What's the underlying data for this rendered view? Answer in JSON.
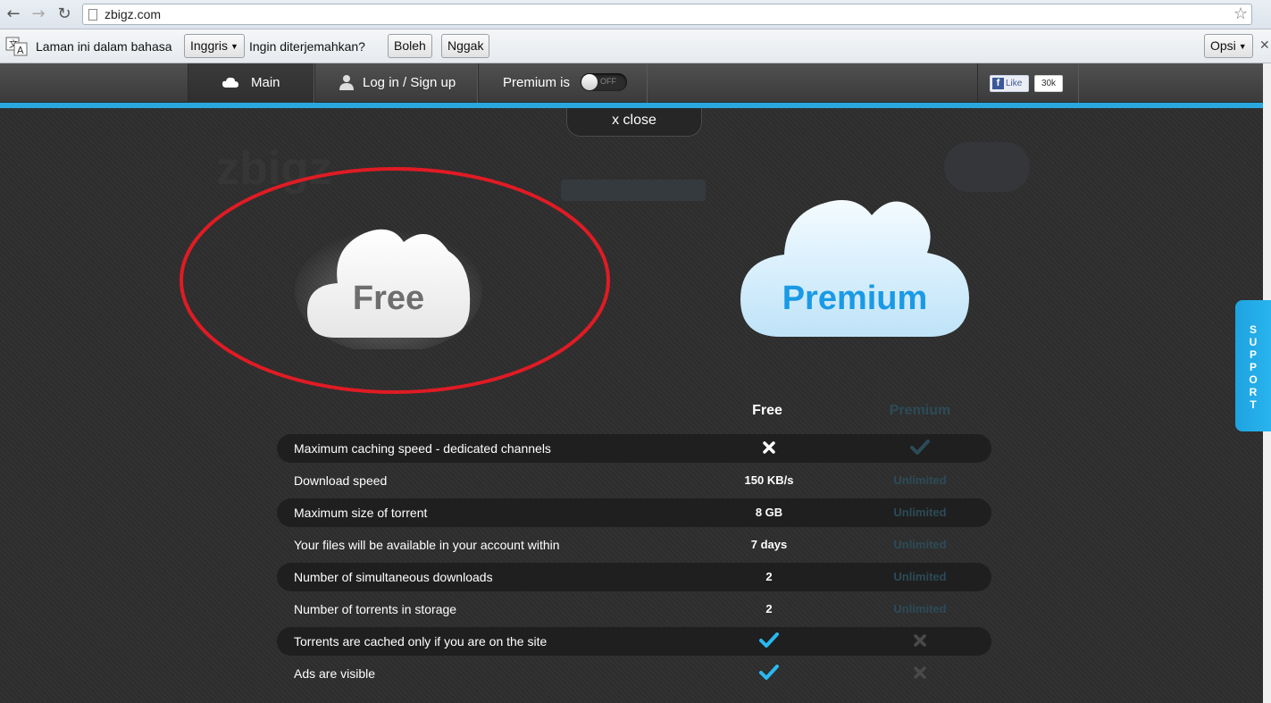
{
  "browser": {
    "url": "zbigz.com",
    "translate_bar": {
      "prefix": "Laman ini dalam bahasa",
      "language": "Inggris",
      "question": "Ingin diterjemahkan?",
      "yes_label": "Boleh",
      "no_label": "Nggak",
      "options_label": "Opsi"
    }
  },
  "sitenav": {
    "main_label": "Main",
    "login_label": "Log in / Sign up",
    "premium_label": "Premium is",
    "toggle_state": "OFF",
    "fb_like": "Like",
    "fb_count": "30k"
  },
  "overlay": {
    "close_label": "x close",
    "free_cloud": "Free",
    "premium_cloud": "Premium",
    "col_free": "Free",
    "col_premium": "Premium",
    "rows": [
      {
        "feature": "Maximum caching speed - dedicated channels",
        "free": "",
        "premium": "",
        "free_icon": "cross-icon",
        "premium_icon": "check-icon"
      },
      {
        "feature": "Download speed",
        "free": "150 KB/s",
        "premium": "Unlimited"
      },
      {
        "feature": "Maximum size of torrent",
        "free": "8 GB",
        "premium": "Unlimited"
      },
      {
        "feature": "Your files will be available in your account within",
        "free": "7 days",
        "premium": "Unlimited"
      },
      {
        "feature": "Number of simultaneous downloads",
        "free": "2",
        "premium": "Unlimited"
      },
      {
        "feature": "Number of torrents in storage",
        "free": "2",
        "premium": "Unlimited"
      },
      {
        "feature": "Torrents are cached only if you are on the site",
        "free": "",
        "premium": "",
        "free_icon": "check-icon",
        "premium_icon": "cross-icon"
      },
      {
        "feature": "Ads are visible",
        "free": "",
        "premium": "",
        "free_icon": "check-icon",
        "premium_icon": "cross-icon"
      }
    ]
  },
  "support_label": "SUPPORT",
  "colors": {
    "accent": "#29a8e0",
    "highlight_ellipse": "#e01b24",
    "premium_text": "#1a9ae6",
    "premium_dim": "#2c4b57"
  }
}
